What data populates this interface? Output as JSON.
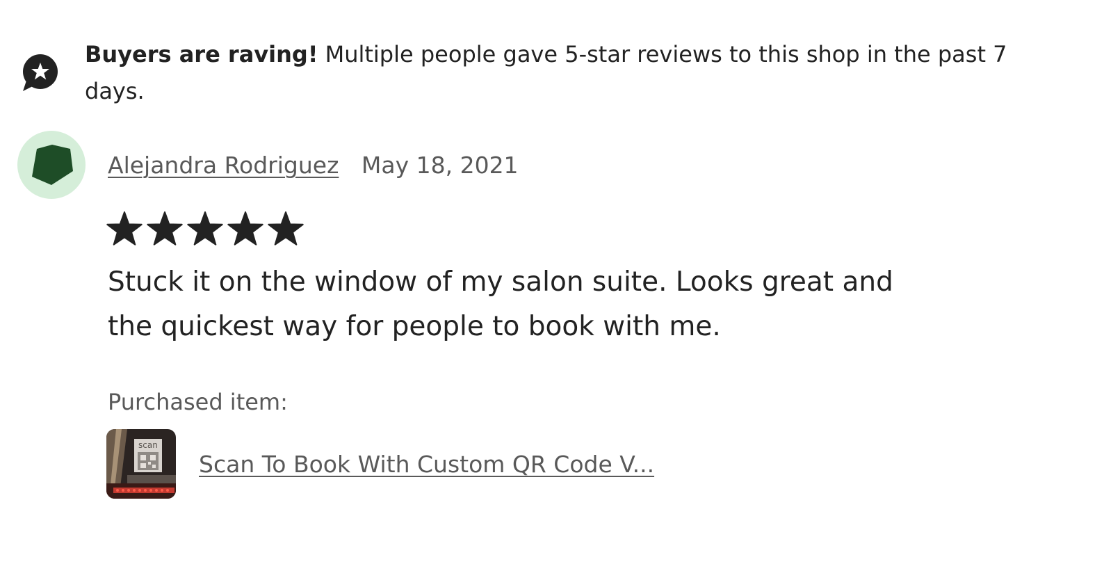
{
  "banner": {
    "icon": "star-speech-bubble-icon",
    "bold_text": "Buyers are raving!",
    "text": " Multiple people gave 5-star reviews to this shop in the past 7 days."
  },
  "review": {
    "avatar_icon": "pentagon-avatar-icon",
    "reviewer_name": "Alejandra Rodriguez",
    "date": "May 18, 2021",
    "rating": 5,
    "rating_max": 5,
    "text": "Stuck it on the window of my salon suite. Looks great and the quickest way for people to book with me.",
    "purchased_label": "Purchased item:",
    "item_title": "Scan To Book With Custom QR Code V...",
    "item_thumbnail_text": "scan"
  },
  "colors": {
    "text_primary": "#222222",
    "text_secondary": "#595959",
    "avatar_bg": "#d5eed9",
    "avatar_shape": "#1e4d27",
    "star": "#222222"
  }
}
